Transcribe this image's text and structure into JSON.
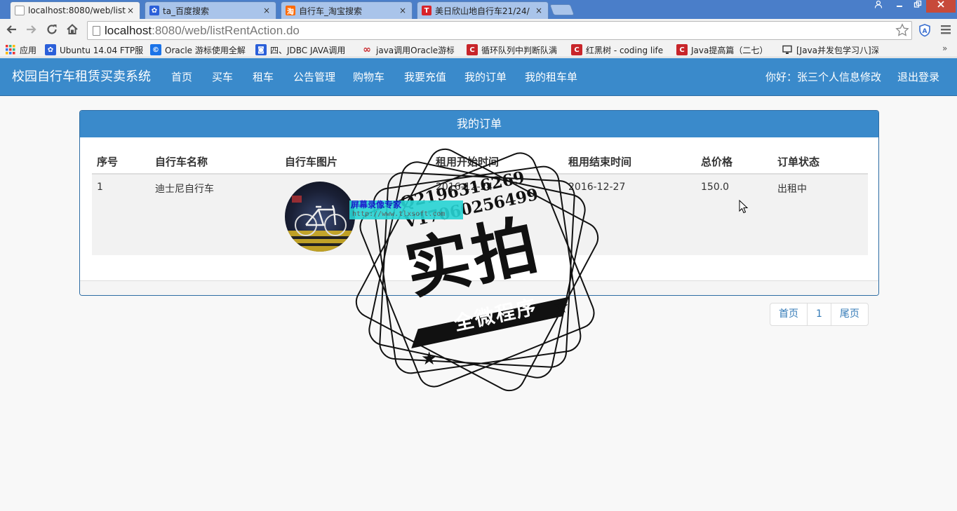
{
  "browser": {
    "tabs": [
      {
        "title": "localhost:8080/web/list",
        "close": "×",
        "active": true,
        "favicon_color": "#7a8aa0"
      },
      {
        "title": "ta_百度搜索",
        "close": "×",
        "active": false,
        "favicon_color": "#2b5fd9"
      },
      {
        "title": "自行车_淘宝搜索",
        "close": "×",
        "active": false,
        "favicon_color": "#ff6a00",
        "favicon_text": "淘"
      },
      {
        "title": "美日欣山地自行车21/24/",
        "close": "×",
        "active": false,
        "favicon_color": "#d8232a",
        "favicon_text": "T"
      }
    ],
    "url_host": "localhost",
    "url_rest": ":8080/web/listRentAction.do",
    "bookmarks": [
      {
        "label": "应用",
        "icon": "apps-grid-icon",
        "color": "#e33"
      },
      {
        "label": "Ubuntu 14.04 FTP服",
        "icon": "baidu-paw-icon",
        "color": "#2b5fd9"
      },
      {
        "label": "Oracle 游标使用全解",
        "icon": "cnblogs-icon",
        "color": "#1a73e8"
      },
      {
        "label": "四、JDBC JAVA调用",
        "icon": "blog-icon",
        "color": "#2b5fd9"
      },
      {
        "label": "java调用Oracle游标",
        "icon": "weibo-icon",
        "color": "#c8252a"
      },
      {
        "label": "循环队列中判断队满",
        "icon": "csdn-icon",
        "color": "#c8252a"
      },
      {
        "label": "红黑树 - coding life",
        "icon": "csdn-icon",
        "color": "#c8252a"
      },
      {
        "label": "Java提高篇（二七）",
        "icon": "csdn-icon",
        "color": "#c8252a"
      },
      {
        "label": "[Java并发包学习八]深",
        "icon": "monitor-icon",
        "color": "#333"
      }
    ]
  },
  "site": {
    "brand": "校园自行车租赁买卖系统",
    "nav": [
      "首页",
      "买车",
      "租车",
      "公告管理",
      "购物车",
      "我要充值",
      "我的订单",
      "我的租车单"
    ],
    "greeting": "你好：张三",
    "profile_link": "个人信息修改",
    "logout": "退出登录"
  },
  "panel": {
    "title": "我的订单",
    "columns": [
      "序号",
      "自行车名称",
      "自行车图片",
      "租用开始时间",
      "租用结束时间",
      "总价格",
      "订单状态"
    ],
    "rows": [
      {
        "index": "1",
        "name": "迪士尼自行车",
        "start": "2016-12-24",
        "end": "2016-12-27",
        "price": "150.0",
        "status": "出租中"
      }
    ]
  },
  "pager": {
    "first": "首页",
    "page": "1",
    "last": "尾页"
  },
  "watermark": {
    "recorder_line1": "屏幕录像专家",
    "recorder_line2": "http://www.tlxsoft.com",
    "qq": "Q2196316269",
    "wechat": "V17060256499",
    "big_text": "实拍",
    "banner": "全微程序"
  },
  "colors": {
    "navbar": "#3a8acb",
    "link": "#337ab7"
  }
}
